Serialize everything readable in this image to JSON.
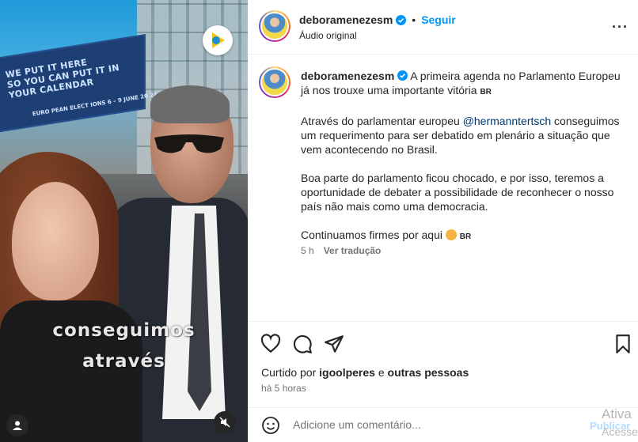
{
  "header": {
    "username": "deboramenezesm",
    "follow_label": "Seguir",
    "audio_label": "Áudio original",
    "more_icon": "more-horizontal-icon"
  },
  "media": {
    "banner_line1": "We put it here",
    "banner_line2": "so you can put it in",
    "banner_line3": "your calendar",
    "banner_sub": "EURO PEAN ELECT IONS 6 – 9 JUNE 20 24",
    "overlay_line1": "conseguimos",
    "overlay_line2": "através"
  },
  "caption": {
    "username": "deboramenezesm",
    "para1": "A primeira agenda no Parlamento Europeu já nos trouxe uma importante vitória",
    "flag1": "BR",
    "para2_before": "Através do parlamentar europeu ",
    "para2_mention": "@hermanntertsch",
    "para2_after": " conseguimos um requerimento para ser debatido em plenário a situação que vem acontecendo no Brasil.",
    "para3": "Boa parte do parlamento ficou chocado, e por isso, teremos a oportunidade de debater a possibilidade de reconhecer o nosso país não mais como uma democracia.",
    "para4": "Continuamos firmes por aqui",
    "flag2": "BR",
    "age": "5 h",
    "translate_label": "Ver tradução"
  },
  "likes": {
    "prefix": "Curtido por ",
    "user": "igoolperes",
    "middle": " e ",
    "others": "outras pessoas"
  },
  "timestamp": "há 5 horas",
  "comment": {
    "placeholder": "Adicione um comentário...",
    "publish_label": "Publicar"
  },
  "watermark": {
    "line1": "Ativa",
    "line2": "Acesse"
  },
  "colors": {
    "link": "#0095f6",
    "mention": "#00376b",
    "muted": "#737373"
  }
}
